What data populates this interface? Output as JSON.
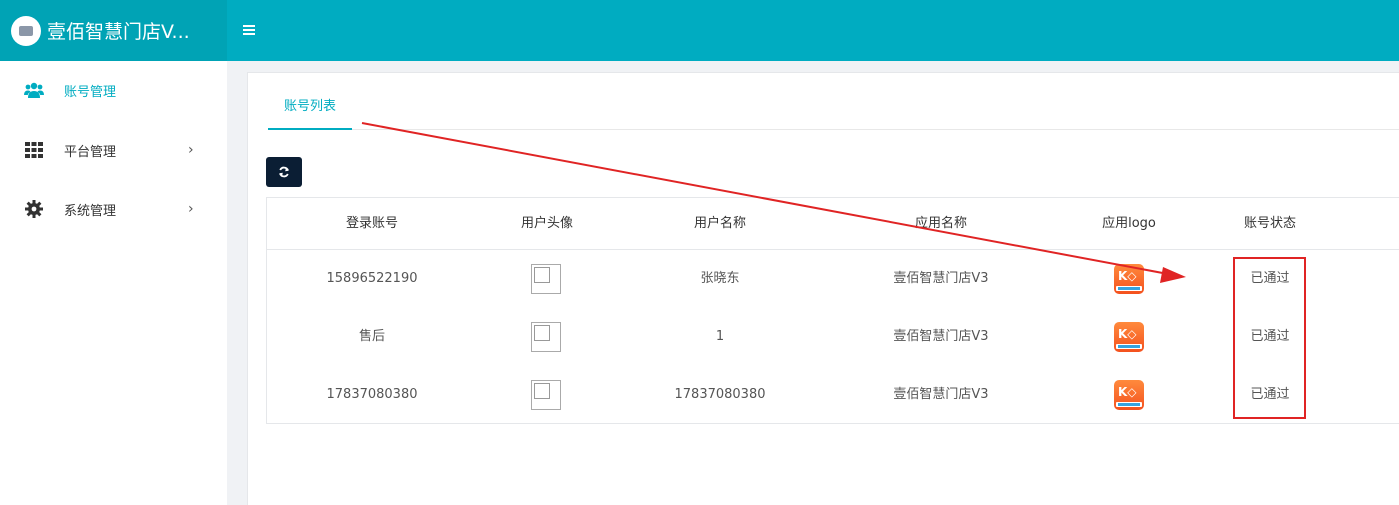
{
  "app": {
    "title": "壹佰智慧门店V..."
  },
  "sidebar": {
    "items": [
      {
        "label": "账号管理",
        "icon": "users-icon",
        "active": true
      },
      {
        "label": "平台管理",
        "icon": "grid-icon",
        "expandable": true
      },
      {
        "label": "系统管理",
        "icon": "gear-icon",
        "expandable": true
      }
    ]
  },
  "tabs": [
    {
      "label": "账号列表",
      "active": true
    }
  ],
  "toolbar": {
    "refresh_icon": "refresh-icon"
  },
  "table": {
    "columns": [
      "登录账号",
      "用户头像",
      "用户名称",
      "应用名称",
      "应用logo",
      "账号状态"
    ],
    "rows": [
      {
        "account": "15896522190",
        "user_name": "张晓东",
        "app_name": "壹佰智慧门店V3",
        "status": "已通过"
      },
      {
        "account": "售后",
        "user_name": "1",
        "app_name": "壹佰智慧门店V3",
        "status": "已通过"
      },
      {
        "account": "17837080380",
        "user_name": "17837080380",
        "app_name": "壹佰智慧门店V3",
        "status": "已通过"
      }
    ]
  },
  "colors": {
    "primary": "#00acc1",
    "brand_bg": "#00a3b5",
    "annotation": "#e02424",
    "button_dark": "#0b1e34"
  }
}
